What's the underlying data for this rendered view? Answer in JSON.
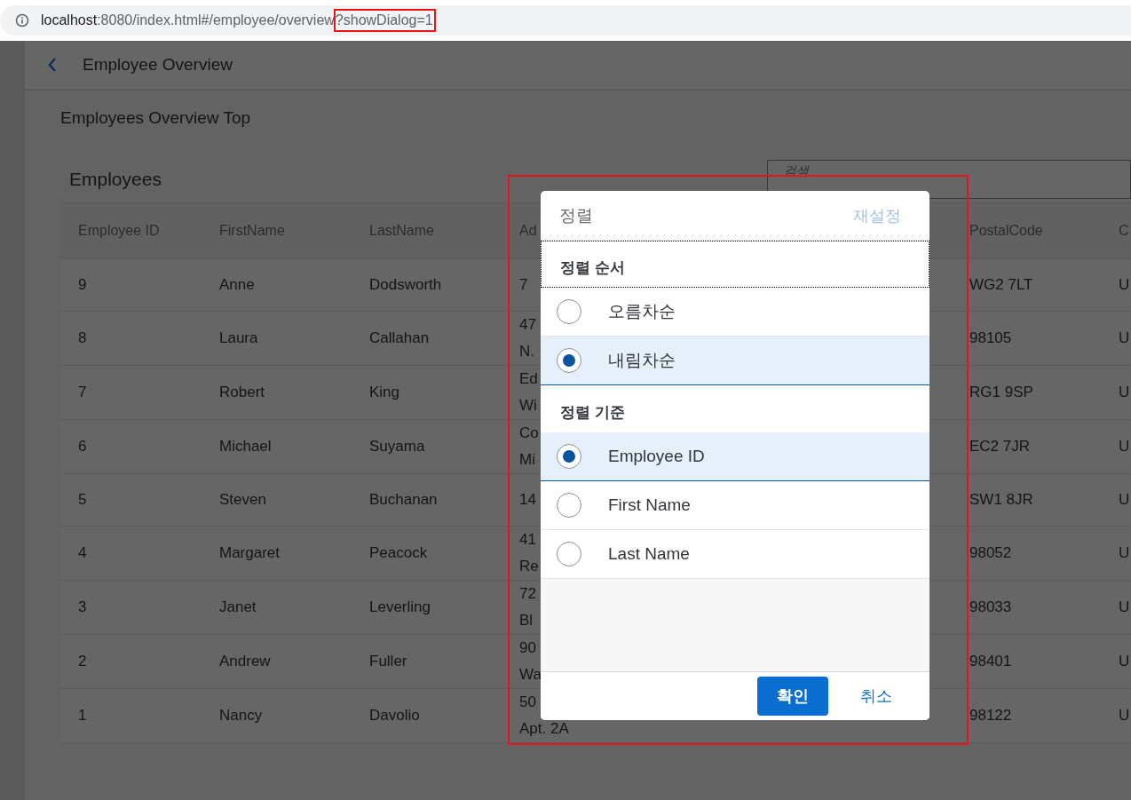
{
  "browser": {
    "host": "localhost",
    "path": ":8080/index.html#/employee/overview",
    "highlighted_query": "?showDialog=1"
  },
  "page": {
    "title": "Employee Overview",
    "section_title": "Employees Overview Top"
  },
  "table": {
    "title": "Employees",
    "search": {
      "placeholder": "검색"
    },
    "columns": [
      "Employee ID",
      "FirstName",
      "LastName",
      "Ad",
      "PostalCode",
      "C"
    ],
    "rows": [
      {
        "cells": [
          "9",
          "Anne",
          "Dodsworth",
          "7",
          "WG2 7LT",
          "U"
        ]
      },
      {
        "cells": [
          "8",
          "Laura",
          "Callahan",
          "47\nN.",
          "98105",
          "U"
        ]
      },
      {
        "cells": [
          "7",
          "Robert",
          "King",
          "Ed\nWi",
          "RG1 9SP",
          "U"
        ]
      },
      {
        "cells": [
          "6",
          "Michael",
          "Suyama",
          "Co\nMi",
          "EC2 7JR",
          "U"
        ]
      },
      {
        "cells": [
          "5",
          "Steven",
          "Buchanan",
          "14",
          "SW1 8JR",
          "U"
        ]
      },
      {
        "cells": [
          "4",
          "Margaret",
          "Peacock",
          "41\nRe",
          "98052",
          "U"
        ]
      },
      {
        "cells": [
          "3",
          "Janet",
          "Leverling",
          "72\nBl",
          "98033",
          "U"
        ]
      },
      {
        "cells": [
          "2",
          "Andrew",
          "Fuller",
          "90\nWa",
          "98401",
          "U"
        ]
      },
      {
        "cells": [
          "1",
          "Nancy",
          "Davolio",
          "50\nApt. 2A",
          "98122",
          "U"
        ]
      }
    ]
  },
  "dialog": {
    "title": "정렬",
    "reset": {
      "label": "재설정",
      "disabled": true
    },
    "groups": [
      {
        "heading": "정렬 순서",
        "focused": true,
        "options": [
          {
            "label": "오름차순",
            "selected": false
          },
          {
            "label": "내림차순",
            "selected": true
          }
        ]
      },
      {
        "heading": "정렬 기준",
        "focused": false,
        "options": [
          {
            "label": "Employee ID",
            "selected": true
          },
          {
            "label": "First Name",
            "selected": false
          },
          {
            "label": "Last Name",
            "selected": false
          }
        ]
      }
    ],
    "buttons": [
      {
        "label": "확인",
        "kind": "emphasized"
      },
      {
        "label": "취소",
        "kind": "transparent"
      }
    ]
  }
}
